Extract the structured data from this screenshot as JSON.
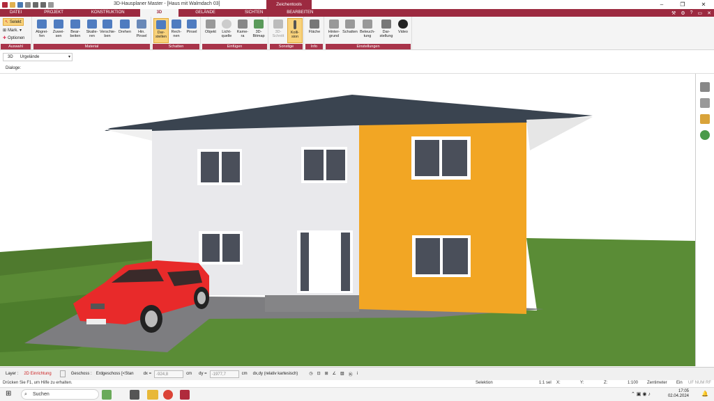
{
  "window": {
    "title": "3D-Hausplaner Master - [Haus mit Walmdach 03]",
    "context_tab": "Zeichentools",
    "minimize": "–",
    "maximize": "❐",
    "close": "✕"
  },
  "tabs": [
    "DATEI",
    "PROJEKT",
    "KONSTRUKTION",
    "3D",
    "GELÄNDE",
    "SICHTEN",
    "BEARBEITEN"
  ],
  "active_tab": "3D",
  "ribbon": {
    "auswahl": {
      "label": "Auswahl",
      "selekt": "Selekt",
      "mark": "Mark.",
      "optionen": "Optionen"
    },
    "material": {
      "label": "Material",
      "buttons": [
        "Abgrei-\nfen",
        "Zuwei-\nsen",
        "Bear-\nbeiten",
        "Skalie-\nren",
        "Verschie-\nben",
        "Drehen",
        "Hin.\nPinsel"
      ]
    },
    "schatten": {
      "label": "Schatten",
      "buttons": [
        "Dar-\nstellen",
        "Rech-\nnen",
        "Pinsel"
      ]
    },
    "einfuegen": {
      "label": "Einfügen",
      "buttons": [
        "Objekt",
        "Licht-\nquelle",
        "Kame-\nra",
        "3D-\nBitmap"
      ]
    },
    "sonstige": {
      "label": "Sonstige",
      "buttons": [
        "3D-\nSchnitt",
        "Kolli-\nsion"
      ]
    },
    "info": {
      "label": "Info",
      "buttons": [
        "Fläche"
      ]
    },
    "einstellungen": {
      "label": "Einstellungen",
      "buttons": [
        "Hinter-\ngrund",
        "Schatten",
        "Beleuch-\ntung",
        "Dar-\nstellung",
        "Video"
      ]
    }
  },
  "layer_select": {
    "prefix": "3D",
    "value": "Urgelände"
  },
  "dialog_label": "Dialoge:",
  "status": {
    "layer_label": "Layer :",
    "layer_value": "2D Einrichtung",
    "geschoss_label": "Geschoss :",
    "geschoss_value": "Erdgeschoss [<Stan",
    "dx_label": "dx =",
    "dx_value": "-924,8",
    "dx_unit": "cm",
    "dy_label": "dy =",
    "dy_value": "-1977,7",
    "dy_unit": "cm",
    "mode": "dx,dy (relativ kartesisch)"
  },
  "info": {
    "help": "Drücken Sie F1, um Hilfe zu erhalten.",
    "mode": "Selektion",
    "sel": "1:1 sel",
    "x": "X:",
    "y": "Y:",
    "z": "Z:",
    "scale": "1:100",
    "unit": "Zentimeter",
    "ein": "Ein",
    "flags": "UF NUM RF"
  },
  "taskbar": {
    "search": "Suchen",
    "time": "17:05",
    "date": "02.04.2024"
  },
  "colors": {
    "accent": "#9c2a40",
    "highlight": "#f8d27b"
  }
}
